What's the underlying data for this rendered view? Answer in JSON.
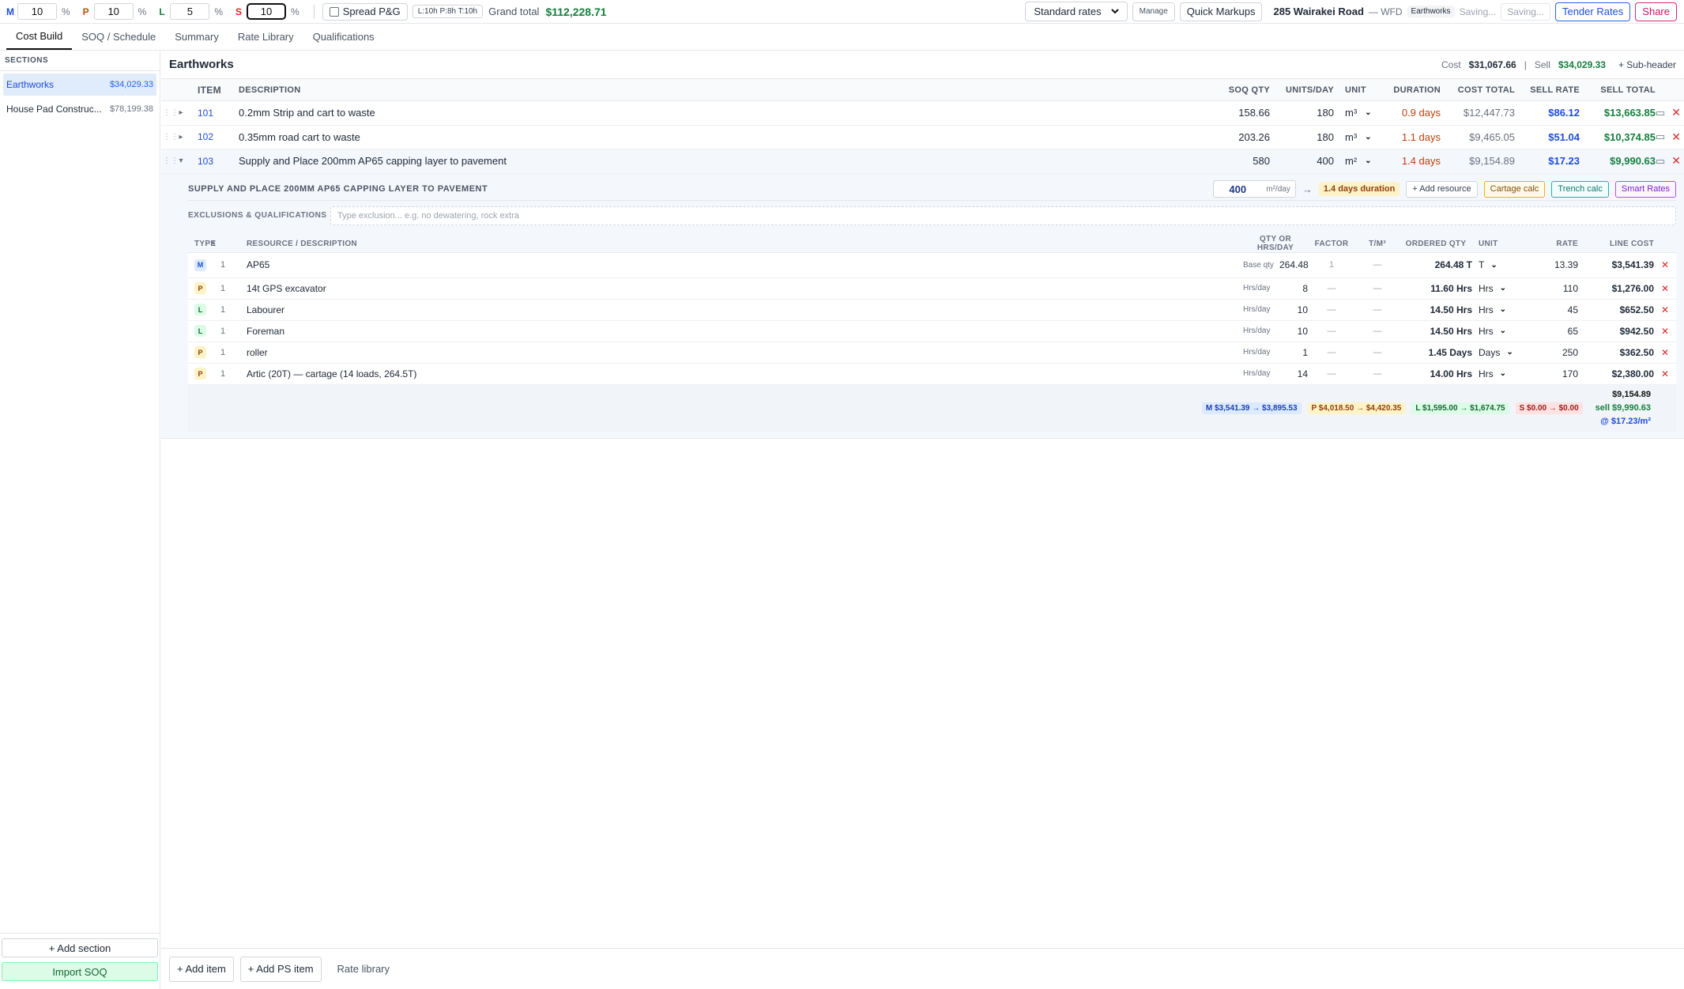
{
  "markups": [
    {
      "letter": "M",
      "value": "10",
      "color": "#1d4ed8"
    },
    {
      "letter": "P",
      "value": "10",
      "color": "#b45309"
    },
    {
      "letter": "L",
      "value": "5",
      "color": "#15803d"
    },
    {
      "letter": "S",
      "value": "10",
      "color": "#dc2626"
    }
  ],
  "pct": "%",
  "spread_label": "Spread P&G",
  "hours_pill": "L:10h P:8h T:10h",
  "grand_total_label": "Grand total",
  "grand_total": "$112,228.71",
  "rate_set": "Standard rates",
  "manage_label": "Manage",
  "quick_markups_label": "Quick Markups",
  "project_name": "285 Wairakei Road",
  "project_code": "— WFD",
  "section_tag": "Earthworks",
  "saving_1": "Saving...",
  "saving_2": "Saving...",
  "tender_rates_label": "Tender Rates",
  "share_label": "Share",
  "tabs": [
    "Cost Build",
    "SOQ / Schedule",
    "Summary",
    "Rate Library",
    "Qualifications"
  ],
  "sidebar": {
    "title": "SECTIONS",
    "items": [
      {
        "name": "Earthworks",
        "amount": "$34,029.33"
      },
      {
        "name": "House Pad Construc...",
        "amount": "$78,199.38"
      }
    ],
    "add_section": "+ Add section",
    "import_soq": "Import SOQ"
  },
  "section": {
    "title": "Earthworks",
    "cost_label": "Cost",
    "cost": "$31,067.66",
    "divider": "|",
    "sell_label": "Sell",
    "sell": "$34,029.33",
    "subheader": "+ Sub-header"
  },
  "columns": {
    "item": "ITEM",
    "description": "DESCRIPTION",
    "soq_qty": "SOQ QTY",
    "units_day": "UNITS/DAY",
    "unit": "UNIT",
    "duration": "DURATION",
    "cost_total": "COST TOTAL",
    "sell_rate": "SELL RATE",
    "sell_total": "SELL TOTAL"
  },
  "items": [
    {
      "item": "101",
      "description": "0.2mm Strip and cart to waste",
      "soq_qty": "158.66",
      "units_day": "180",
      "unit": "m³",
      "duration": "0.9 days",
      "cost_total": "$12,447.73",
      "sell_rate": "$86.12",
      "sell_total": "$13,663.85"
    },
    {
      "item": "102",
      "description": "0.35mm road cart to waste",
      "soq_qty": "203.26",
      "units_day": "180",
      "unit": "m³",
      "duration": "1.1 days",
      "cost_total": "$9,465.05",
      "sell_rate": "$51.04",
      "sell_total": "$10,374.85"
    },
    {
      "item": "103",
      "description": "Supply and Place 200mm AP65 capping layer to pavement",
      "soq_qty": "580",
      "units_day": "400",
      "unit": "m²",
      "duration": "1.4 days",
      "cost_total": "$9,154.89",
      "sell_rate": "$17.23",
      "sell_total": "$9,990.63"
    }
  ],
  "detail": {
    "title": "SUPPLY AND PLACE 200MM AP65 CAPPING LAYER TO PAVEMENT",
    "rate_value": "400",
    "rate_unit": "m²/day",
    "arrow": "→",
    "duration_badge": "1.4 days duration",
    "add_resource": "+ Add resource",
    "cartage_calc": "Cartage calc",
    "trench_calc": "Trench calc",
    "smart_rates": "Smart Rates",
    "excl_label": "EXCLUSIONS & QUALIFICATIONS",
    "excl_placeholder": "Type exclusion... e.g. no dewatering, rock extra",
    "res_columns": {
      "type": "TYPE",
      "x": "×",
      "desc": "RESOURCE / DESCRIPTION",
      "qty": "QTY OR HRS/DAY",
      "factor": "FACTOR",
      "tm": "T/M³",
      "ordered": "ORDERED QTY",
      "unit": "UNIT",
      "rate": "RATE",
      "line_cost": "LINE COST"
    },
    "resources": [
      {
        "type": "M",
        "mult": "1",
        "desc": "AP65",
        "mode": "Base qty",
        "qty": "264.48",
        "factor": "1",
        "tm": "—",
        "ordered": "264.48 T",
        "unit": "T",
        "rate": "13.39",
        "line_cost": "$3,541.39"
      },
      {
        "type": "P",
        "mult": "1",
        "desc": "14t GPS excavator",
        "mode": "Hrs/day",
        "qty": "8",
        "factor": "—",
        "tm": "—",
        "ordered": "11.60 Hrs",
        "unit": "Hrs",
        "rate": "110",
        "line_cost": "$1,276.00"
      },
      {
        "type": "L",
        "mult": "1",
        "desc": "Labourer",
        "mode": "Hrs/day",
        "qty": "10",
        "factor": "—",
        "tm": "—",
        "ordered": "14.50 Hrs",
        "unit": "Hrs",
        "rate": "45",
        "line_cost": "$652.50"
      },
      {
        "type": "L",
        "mult": "1",
        "desc": "Foreman",
        "mode": "Hrs/day",
        "qty": "10",
        "factor": "—",
        "tm": "—",
        "ordered": "14.50 Hrs",
        "unit": "Hrs",
        "rate": "65",
        "line_cost": "$942.50"
      },
      {
        "type": "P",
        "mult": "1",
        "desc": "roller",
        "mode": "Hrs/day",
        "qty": "1",
        "factor": "—",
        "tm": "—",
        "ordered": "1.45 Days",
        "unit": "Days",
        "rate": "250",
        "line_cost": "$362.50"
      },
      {
        "type": "P",
        "mult": "1",
        "desc": "Artic (20T) — cartage (14 loads, 264.5T)",
        "mode": "Hrs/day",
        "qty": "14",
        "factor": "—",
        "tm": "—",
        "ordered": "14.00 Hrs",
        "unit": "Hrs",
        "rate": "170",
        "line_cost": "$2,380.00"
      }
    ],
    "chips": [
      {
        "type": "M",
        "text": "M $3,541.39 → $3,895.53"
      },
      {
        "type": "P",
        "text": "P $4,018.50 → $4,420.35"
      },
      {
        "type": "L",
        "text": "L $1,595.00 → $1,674.75"
      },
      {
        "type": "S",
        "text": "S $0.00 → $0.00"
      }
    ],
    "total_cost": "$9,154.89",
    "total_sell": "sell $9,990.63",
    "total_rate": "@ $17.23/m²"
  },
  "bottom": {
    "add_item": "+ Add item",
    "add_ps_item": "+ Add PS item",
    "rate_library": "Rate library"
  }
}
